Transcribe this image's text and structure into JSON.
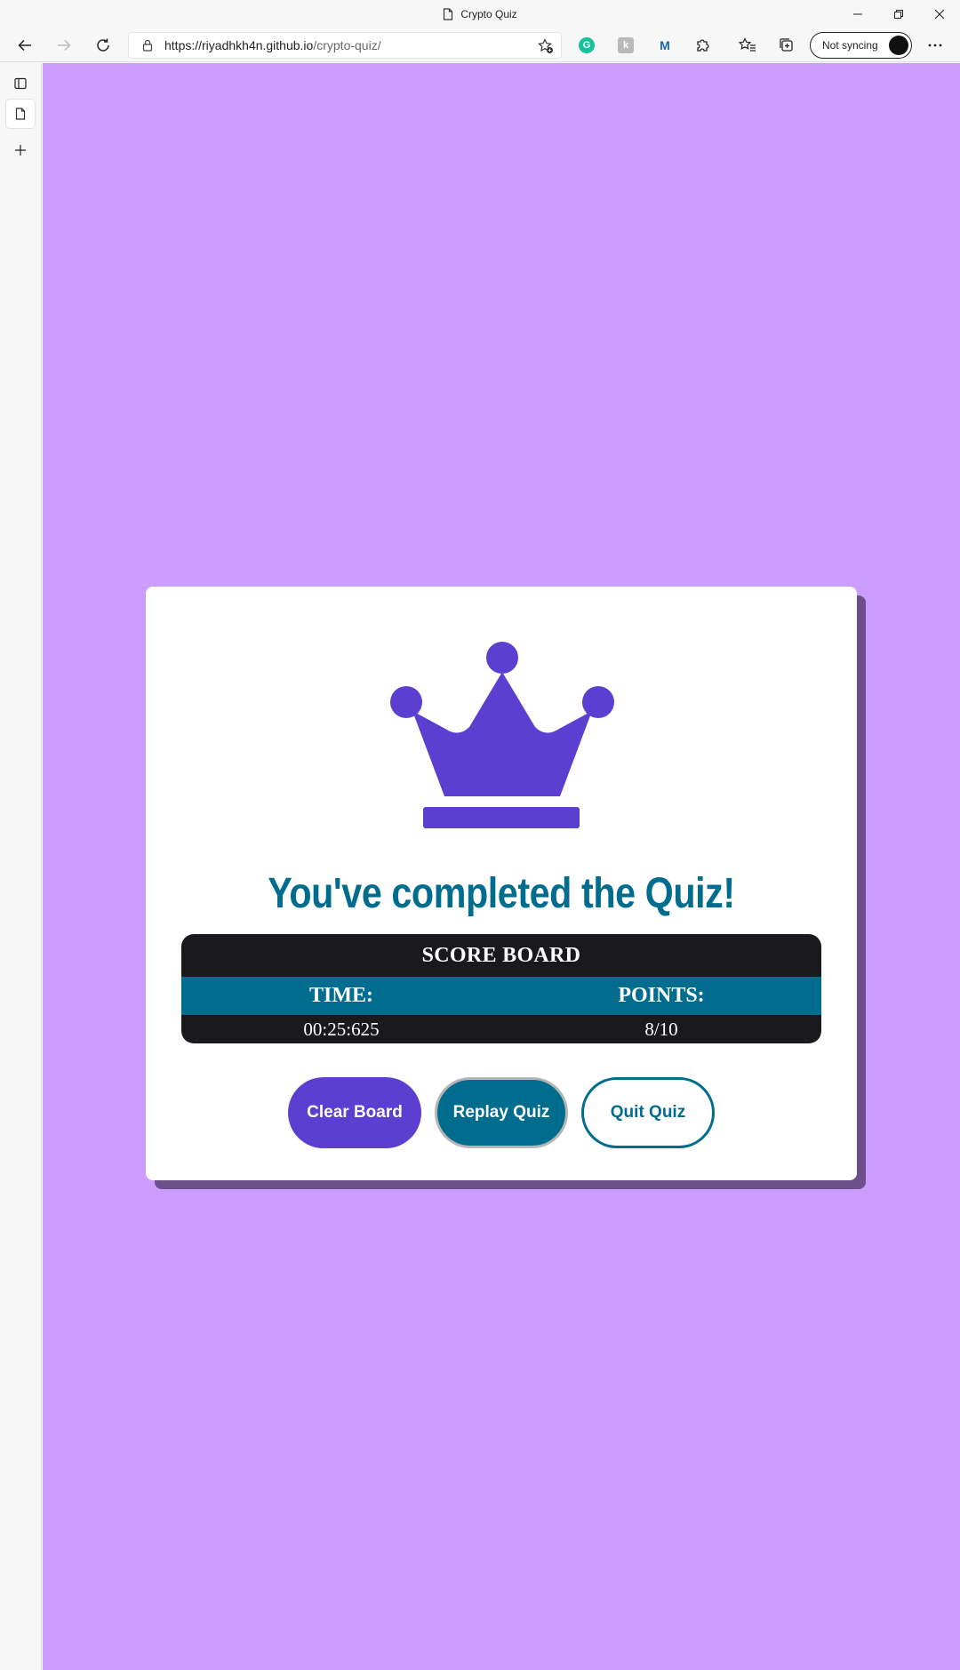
{
  "browser": {
    "tab_title": "Crypto Quiz",
    "url_host": "https://riyadhkh4n.github.io",
    "url_path": "/crypto-quiz/",
    "sync_label": "Not syncing"
  },
  "quiz": {
    "heading": "You've completed the Quiz!",
    "scoreboard": {
      "title": "SCORE BOARD",
      "time_label": "TIME:",
      "points_label": "POINTS:",
      "time_value": "00:25:625",
      "points_value": "8/10"
    },
    "buttons": {
      "clear": "Clear Board",
      "replay": "Replay Quiz",
      "quit": "Quit Quiz"
    }
  },
  "colors": {
    "page_bg": "#cc9dff",
    "accent_purple": "#5b3fd1",
    "accent_teal": "#006d8f",
    "scoreboard_bg": "#1a1a1e"
  },
  "icons": [
    "page-icon",
    "back-icon",
    "forward-icon",
    "refresh-icon",
    "lock-icon",
    "favorite-add-icon",
    "grammarly-icon",
    "extension-icon",
    "malwarebytes-icon",
    "puzzle-icon",
    "favorites-icon",
    "collections-icon",
    "more-icon",
    "crown-icon"
  ]
}
